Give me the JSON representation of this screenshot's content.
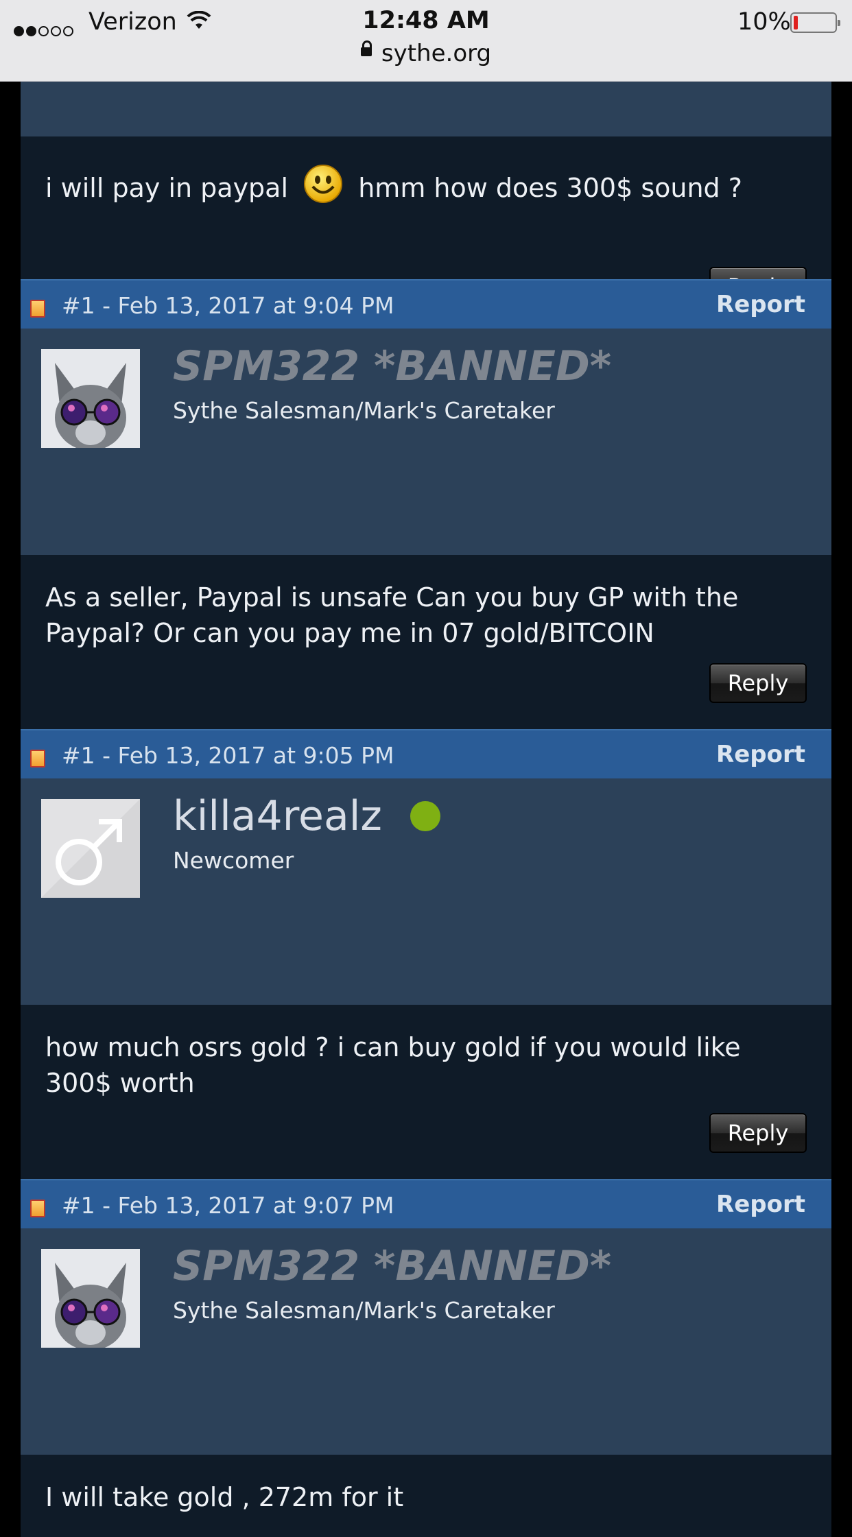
{
  "status_bar": {
    "carrier": "Verizon",
    "time": "12:48 AM",
    "battery_percent": "10%",
    "url": "sythe.org",
    "signal_bars": 2,
    "battery_level": 0.1
  },
  "colors": {
    "header_blue": "#2a5c97",
    "user_block": "#2c4159",
    "message_bg": "#0f1b28",
    "online": "#7fb013"
  },
  "posts": [
    {
      "message": "i will pay in paypal",
      "message_after_emoji": "hmm how does 300$ sound ?",
      "reply_label": "Reply"
    },
    {
      "meta": "#1 - Feb 13, 2017 at 9:04 PM",
      "report_label": "Report",
      "username": "SPM322 *BANNED*",
      "user_title": "Sythe Salesman/Mark's Caretaker",
      "message": "As a seller, Paypal is unsafe Can you buy GP with the Paypal? Or can you pay me in 07 gold/BITCOIN",
      "reply_label": "Reply"
    },
    {
      "meta": "#1 - Feb 13, 2017 at 9:05 PM",
      "report_label": "Report",
      "username": "killa4realz",
      "user_title": "Newcomer",
      "message": "how much osrs gold ? i can buy gold if you would like 300$ worth",
      "reply_label": "Reply"
    },
    {
      "meta": "#1 - Feb 13, 2017 at 9:07 PM",
      "report_label": "Report",
      "username": "SPM322 *BANNED*",
      "user_title": "Sythe Salesman/Mark's Caretaker",
      "message": "I will take gold , 272m for it"
    }
  ]
}
